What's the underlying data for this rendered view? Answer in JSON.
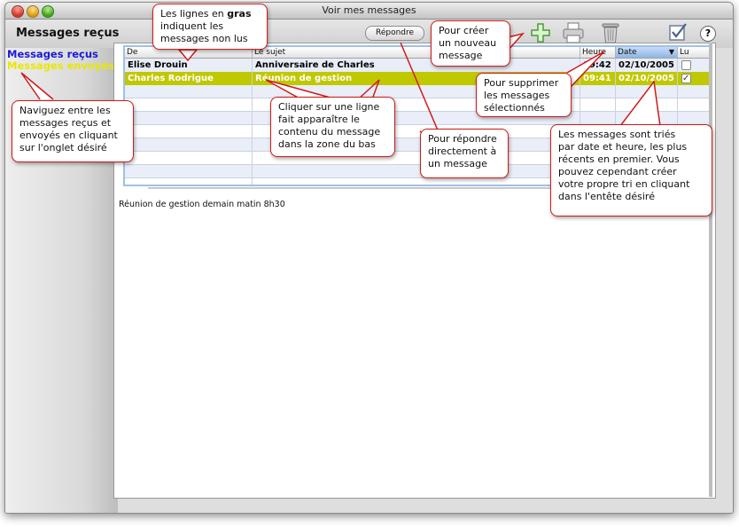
{
  "window": {
    "title": "Voir mes messages"
  },
  "section_title": "Messages reçus",
  "sidebar": {
    "tabs": [
      {
        "label": "Messages reçus",
        "color": "#1a1ad8"
      },
      {
        "label": "Messages envoyés",
        "color": "#e8e800"
      }
    ]
  },
  "toolbar": {
    "reply_label": "Répondre",
    "icons": [
      "add-icon",
      "print-icon",
      "trash-icon",
      "checklist-icon",
      "help-icon"
    ],
    "help_glyph": "?"
  },
  "table": {
    "headers": {
      "from": "De",
      "subject": "Le sujet",
      "time": "Heure",
      "date": "Date",
      "read": "Lu"
    },
    "sorted_column": "date",
    "rows": [
      {
        "from": "Elise Drouin",
        "subject": "Anniversaire de Charles",
        "time": "09:42",
        "date": "02/10/2005",
        "read": false,
        "selected": false
      },
      {
        "from": "Charles Rodrigue",
        "subject": "Réunion de gestion",
        "time": "09:41",
        "date": "02/10/2005",
        "read": true,
        "selected": true
      }
    ]
  },
  "preview_text": "Réunion de gestion demain matin 8h30",
  "callouts": {
    "bold": {
      "line1_prefix": "Les lignes en ",
      "line1_bold": "gras",
      "line2": "indiquent les",
      "line3": "messages non lus"
    },
    "create": [
      "Pour créer",
      "un nouveau",
      "message"
    ],
    "delete": [
      "Pour supprimer",
      "les messages",
      "sélectionnés"
    ],
    "navigate": [
      "Naviguez entre les",
      "messages reçus et",
      "envoyés en cliquant",
      "sur l'onglet désiré"
    ],
    "click_row": [
      "Cliquer sur une ligne",
      "fait apparaître le",
      "contenu du message",
      "dans la zone du bas"
    ],
    "reply": [
      "Pour répondre",
      "directement à",
      "un message"
    ],
    "sort": [
      "Les messages sont triés",
      "par date et heure, les plus",
      "récents en premier. Vous",
      "pouvez cependant créer",
      "votre propre tri en cliquant",
      "dans l'entête désiré"
    ]
  }
}
